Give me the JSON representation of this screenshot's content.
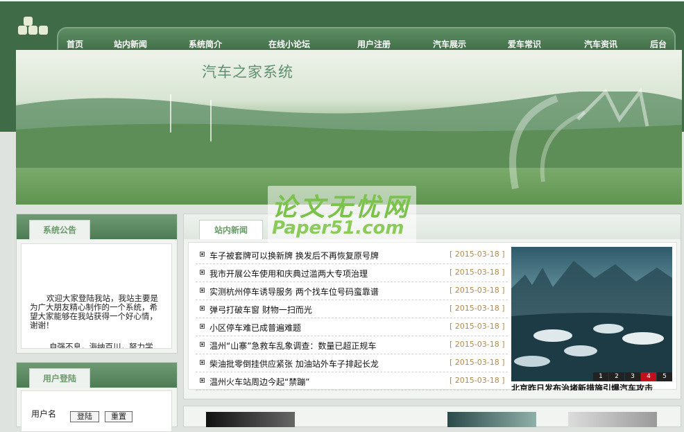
{
  "site": {
    "banner_title": "汽车之家系统"
  },
  "nav": {
    "items": [
      {
        "label": "首页"
      },
      {
        "label": "站内新闻"
      },
      {
        "label": "系统简介"
      },
      {
        "label": "在线小论坛"
      },
      {
        "label": "用户注册"
      },
      {
        "label": "汽车展示"
      },
      {
        "label": "爱车常识"
      },
      {
        "label": "汽车资讯"
      },
      {
        "label": "后台"
      }
    ]
  },
  "watermark": {
    "line1": "论文无忧网",
    "line2": "Paper51.com"
  },
  "notice": {
    "title": "系统公告",
    "text": "欢迎大家登陆我站，我站主要是为广大朋友精心制作的一个系统，希望大家能够在我站获得一个好心情，谢谢！",
    "more_text": "自强不息，海纳百川，努力学"
  },
  "login": {
    "title": "用户登陆",
    "username_label": "用户名",
    "login_button": "登陆",
    "reset_button": "重置"
  },
  "news": {
    "title": "站内新闻",
    "items": [
      {
        "title": "车子被套牌可以换新牌  换发后不再恢复原号牌",
        "date": "[ 2015-03-18 ]"
      },
      {
        "title": "我市开展公车使用和庆典过滥两大专项治理",
        "date": "[ 2015-03-18 ]"
      },
      {
        "title": "实测杭州停车诱导服务  两个找车位号码蛮靠谱",
        "date": "[ 2015-03-18 ]"
      },
      {
        "title": "弹弓打破车窗  财物一扫而光",
        "date": "[ 2015-03-18 ]"
      },
      {
        "title": "小区停车难已成普遍难题",
        "date": "[ 2015-03-18 ]"
      },
      {
        "title": "温州“山寨”急救车乱象调查：数量已超正规车",
        "date": "[ 2015-03-18 ]"
      },
      {
        "title": "柴油批零倒挂供应紧张  加油站外车子排起长龙",
        "date": "[ 2015-03-18 ]"
      },
      {
        "title": "温州火车站周边今起“禁蹦”",
        "date": "[ 2015-03-18 ]"
      }
    ],
    "photo_caption": "北京昨日发布治堵新措施引爆汽车攻击",
    "pages": [
      "1",
      "2",
      "3",
      "4",
      "5"
    ],
    "active_page": "4"
  },
  "colors": {
    "brand_green": "#3f6b46",
    "tab_text": "#6a9a6a",
    "date": "#b08a4a",
    "pager_active": "#c0111b"
  }
}
